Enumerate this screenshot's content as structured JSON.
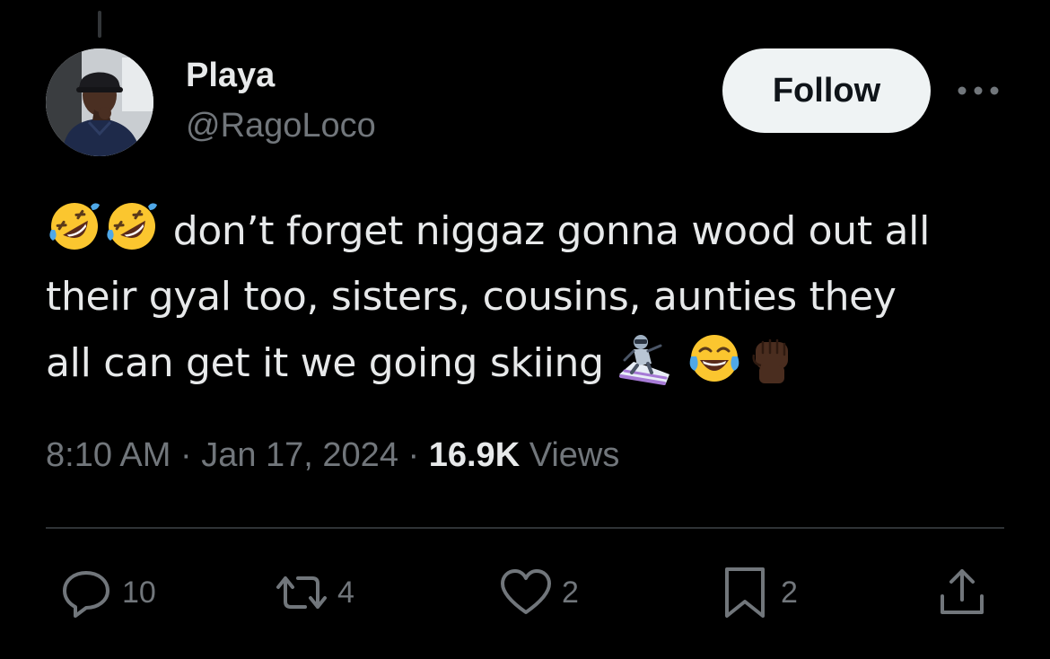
{
  "author": {
    "display_name": "Playa",
    "handle": "@RagoLoco",
    "avatar_icon": "profile-photo"
  },
  "header": {
    "follow_label": "Follow",
    "more_icon": "more-dots-icon"
  },
  "tweet": {
    "line1_text": "don’t forget niggaz gonna  wood out all",
    "line2_text": "their gyal too, sisters, cousins, aunties they",
    "line3_text": "all can get it we going skiing",
    "emojis": [
      "rolling-on-floor-laughing",
      "rolling-on-floor-laughing",
      "skier",
      "face-with-tears-of-joy",
      "raised-fist-dark-skin"
    ]
  },
  "meta": {
    "time": "8:10 AM",
    "separator": " · ",
    "date": "Jan 17, 2024",
    "views_count": "16.9K",
    "views_label": " Views"
  },
  "actions": {
    "replies": "10",
    "reposts": "4",
    "likes": "2",
    "bookmarks": "2"
  },
  "colors": {
    "background": "#000000",
    "text_primary": "#e7e9ea",
    "text_secondary": "#71767b",
    "follow_bg": "#eff3f4",
    "divider": "#2f3336"
  }
}
